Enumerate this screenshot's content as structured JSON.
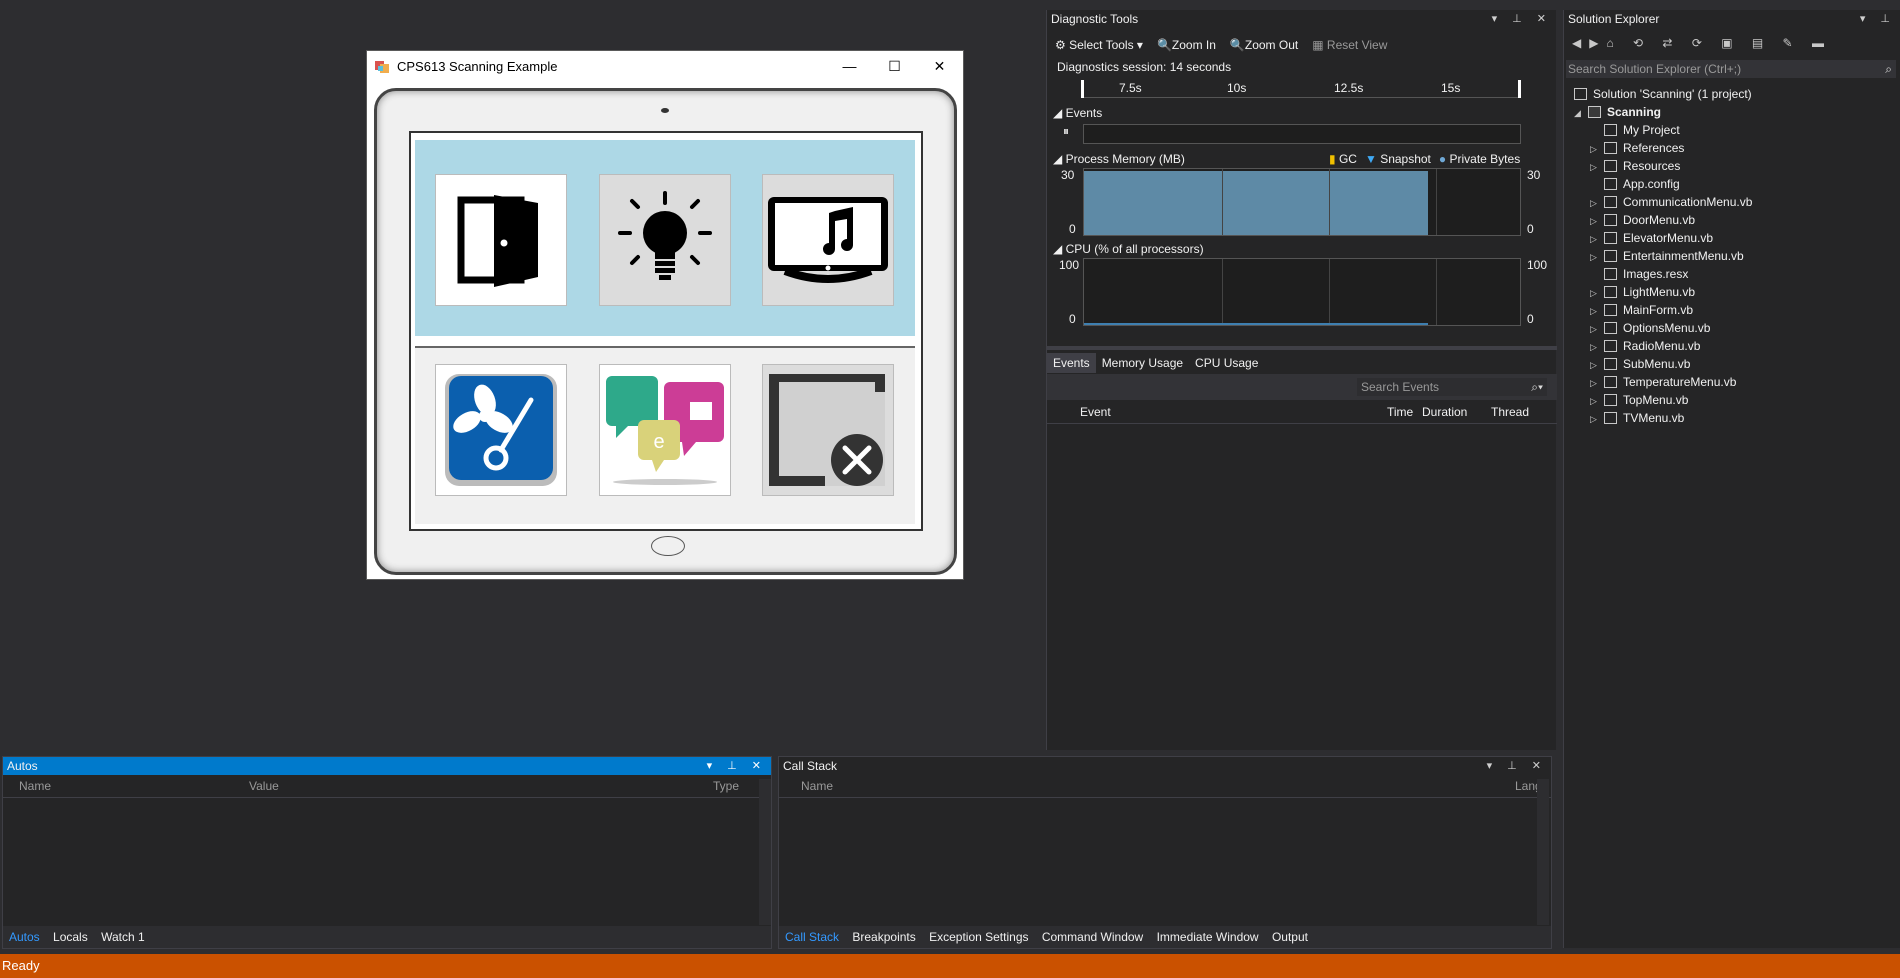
{
  "app_window": {
    "title": "CPS613 Scanning Example",
    "min_glyph": "—",
    "max_glyph": "☐",
    "close_glyph": "✕"
  },
  "tiles": [
    {
      "name": "door",
      "icon": "door-icon"
    },
    {
      "name": "light",
      "icon": "lightbulb-icon"
    },
    {
      "name": "entertainment",
      "icon": "tv-music-icon"
    },
    {
      "name": "temperature",
      "icon": "fan-thermometer-icon"
    },
    {
      "name": "communication",
      "icon": "chat-bubbles-icon"
    },
    {
      "name": "exit",
      "icon": "close-window-icon"
    }
  ],
  "diagnostic_tools": {
    "title": "Diagnostic Tools",
    "toolbar": {
      "select_tools": "Select Tools",
      "zoom_in": "Zoom In",
      "zoom_out": "Zoom Out",
      "reset_view": "Reset View"
    },
    "session": "Diagnostics session: 14 seconds",
    "timeline_ticks": [
      "7.5s",
      "10s",
      "12.5s",
      "15s"
    ],
    "events_label": "Events",
    "memory_label": "Process Memory (MB)",
    "legend": {
      "gc": "GC",
      "snapshot": "Snapshot",
      "private_bytes": "Private Bytes"
    },
    "memory_axis": {
      "top": "30",
      "bottom": "0"
    },
    "cpu_label": "CPU (% of all processors)",
    "cpu_axis": {
      "top": "100",
      "bottom": "0"
    },
    "tabs": [
      "Events",
      "Memory Usage",
      "CPU Usage"
    ],
    "search_placeholder": "Search Events",
    "columns": [
      "Event",
      "Time",
      "Duration",
      "Thread"
    ]
  },
  "solution_explorer": {
    "title": "Solution Explorer",
    "search_placeholder": "Search Solution Explorer (Ctrl+;)",
    "solution": "Solution 'Scanning' (1 project)",
    "project": "Scanning",
    "items": [
      {
        "label": "My Project",
        "expandable": false
      },
      {
        "label": "References",
        "expandable": true
      },
      {
        "label": "Resources",
        "expandable": true
      },
      {
        "label": "App.config",
        "expandable": false
      },
      {
        "label": "CommunicationMenu.vb",
        "expandable": true
      },
      {
        "label": "DoorMenu.vb",
        "expandable": true
      },
      {
        "label": "ElevatorMenu.vb",
        "expandable": true
      },
      {
        "label": "EntertainmentMenu.vb",
        "expandable": true
      },
      {
        "label": "Images.resx",
        "expandable": false
      },
      {
        "label": "LightMenu.vb",
        "expandable": true
      },
      {
        "label": "MainForm.vb",
        "expandable": true
      },
      {
        "label": "OptionsMenu.vb",
        "expandable": true
      },
      {
        "label": "RadioMenu.vb",
        "expandable": true
      },
      {
        "label": "SubMenu.vb",
        "expandable": true
      },
      {
        "label": "TemperatureMenu.vb",
        "expandable": true
      },
      {
        "label": "TopMenu.vb",
        "expandable": true
      },
      {
        "label": "TVMenu.vb",
        "expandable": true
      }
    ]
  },
  "autos": {
    "title": "Autos",
    "columns": [
      "Name",
      "Value",
      "Type"
    ],
    "tabs": [
      "Autos",
      "Locals",
      "Watch 1"
    ]
  },
  "call_stack": {
    "title": "Call Stack",
    "columns": [
      "Name",
      "Lang"
    ],
    "tabs": [
      "Call Stack",
      "Breakpoints",
      "Exception Settings",
      "Command Window",
      "Immediate Window",
      "Output"
    ]
  },
  "status": {
    "text": "Ready",
    "color": "#ca5100"
  },
  "colors": {
    "accent": "#007acc",
    "panel_bg": "#252526",
    "ide_bg": "#2d2d30",
    "tile_row_bg": "#add8e6"
  }
}
